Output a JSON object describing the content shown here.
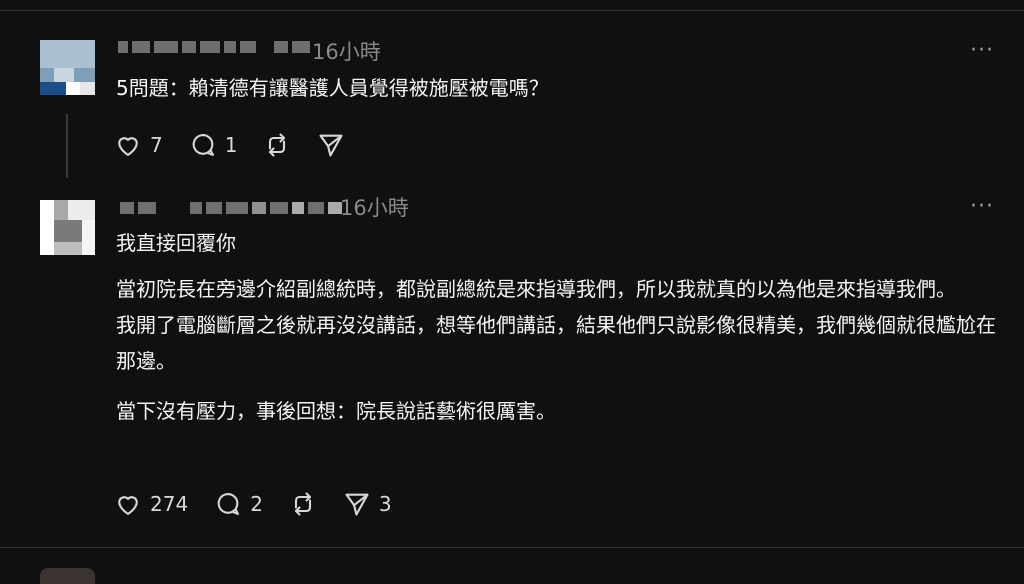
{
  "posts": [
    {
      "time": "16小時",
      "more": "···",
      "paragraphs": [
        "5問題：賴清德有讓醫護人員覺得被施壓被電嗎？"
      ],
      "actions": {
        "likes": "7",
        "replies": "1",
        "reposts": "",
        "shares": ""
      }
    },
    {
      "time": "16小時",
      "more": "···",
      "paragraphs": [
        "我直接回覆你",
        "當初院長在旁邊介紹副總統時，都說副總統是來指導我們，所以我就真的以為他是來指導我們。\n我開了電腦斷層之後就再沒沒講話，想等他們講話，結果他們只說影像很精美，我們幾個就很尷尬在那邊。",
        "當下沒有壓力，事後回想：院長說話藝術很厲害。"
      ],
      "actions": {
        "likes": "274",
        "replies": "2",
        "reposts": "",
        "shares": "3"
      }
    }
  ],
  "icons": {
    "like": "heart-icon",
    "reply": "comment-icon",
    "repost": "repost-icon",
    "share": "send-icon",
    "more": "more-icon"
  },
  "colors": {
    "background": "#101010",
    "text": "#f3f5f7",
    "muted": "#8a8a8a"
  }
}
